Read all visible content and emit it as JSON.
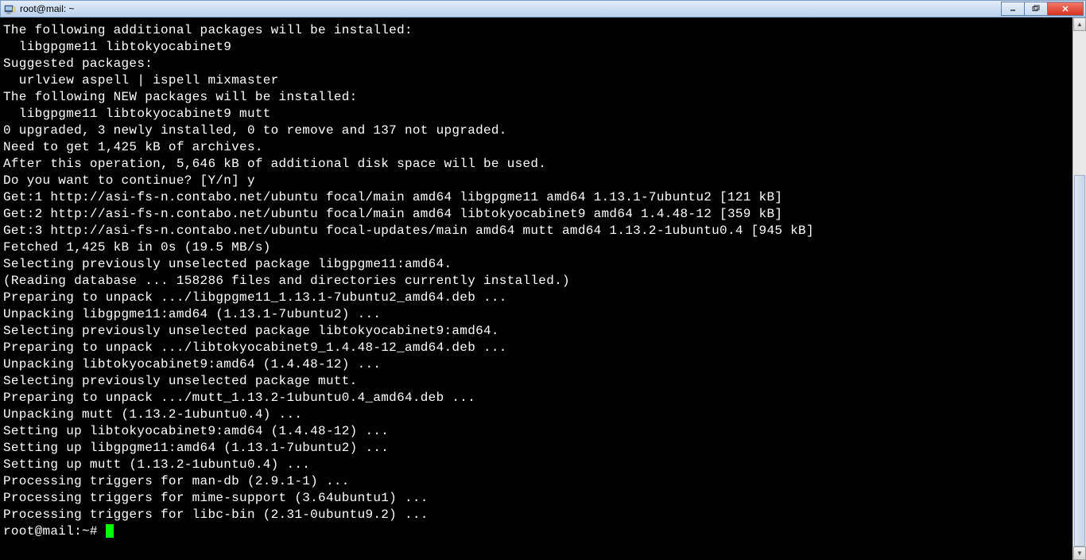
{
  "window": {
    "title": "root@mail: ~"
  },
  "terminal": {
    "lines": [
      "The following additional packages will be installed:",
      "  libgpgme11 libtokyocabinet9",
      "Suggested packages:",
      "  urlview aspell | ispell mixmaster",
      "The following NEW packages will be installed:",
      "  libgpgme11 libtokyocabinet9 mutt",
      "0 upgraded, 3 newly installed, 0 to remove and 137 not upgraded.",
      "Need to get 1,425 kB of archives.",
      "After this operation, 5,646 kB of additional disk space will be used.",
      "Do you want to continue? [Y/n] y",
      "Get:1 http://asi-fs-n.contabo.net/ubuntu focal/main amd64 libgpgme11 amd64 1.13.1-7ubuntu2 [121 kB]",
      "Get:2 http://asi-fs-n.contabo.net/ubuntu focal/main amd64 libtokyocabinet9 amd64 1.4.48-12 [359 kB]",
      "Get:3 http://asi-fs-n.contabo.net/ubuntu focal-updates/main amd64 mutt amd64 1.13.2-1ubuntu0.4 [945 kB]",
      "Fetched 1,425 kB in 0s (19.5 MB/s)",
      "Selecting previously unselected package libgpgme11:amd64.",
      "(Reading database ... 158286 files and directories currently installed.)",
      "Preparing to unpack .../libgpgme11_1.13.1-7ubuntu2_amd64.deb ...",
      "Unpacking libgpgme11:amd64 (1.13.1-7ubuntu2) ...",
      "Selecting previously unselected package libtokyocabinet9:amd64.",
      "Preparing to unpack .../libtokyocabinet9_1.4.48-12_amd64.deb ...",
      "Unpacking libtokyocabinet9:amd64 (1.4.48-12) ...",
      "Selecting previously unselected package mutt.",
      "Preparing to unpack .../mutt_1.13.2-1ubuntu0.4_amd64.deb ...",
      "Unpacking mutt (1.13.2-1ubuntu0.4) ...",
      "Setting up libtokyocabinet9:amd64 (1.4.48-12) ...",
      "Setting up libgpgme11:amd64 (1.13.1-7ubuntu2) ...",
      "Setting up mutt (1.13.2-1ubuntu0.4) ...",
      "Processing triggers for man-db (2.9.1-1) ...",
      "Processing triggers for mime-support (3.64ubuntu1) ...",
      "Processing triggers for libc-bin (2.31-0ubuntu9.2) ..."
    ],
    "prompt": "root@mail:~# "
  }
}
